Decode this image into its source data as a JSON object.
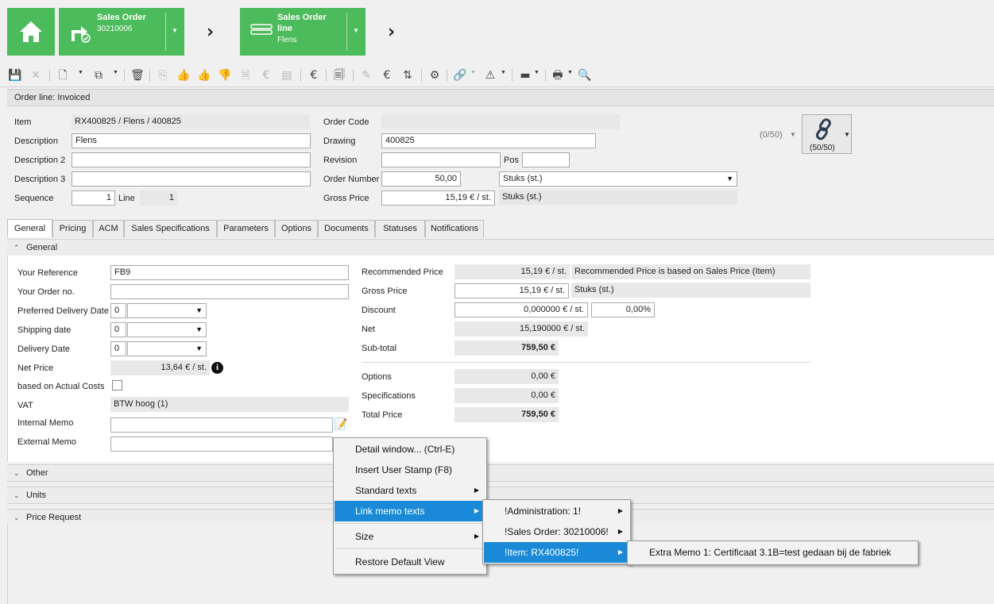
{
  "breadcrumb": {
    "tile1": {
      "title": "Sales Order",
      "sub": "30210006"
    },
    "tile2": {
      "title": "Sales Order",
      "title2": "line",
      "sub": "Flens"
    }
  },
  "colors": {
    "accent": "#4cbb5b",
    "highlight": "#1a8ad8"
  },
  "toolbar": {
    "icons": [
      "save-icon",
      "discard-icon",
      "new-document-icon",
      "copy-icon",
      "delete-icon",
      "process-icon",
      "approve-icon",
      "approve-all-icon",
      "reject-icon",
      "invoice-icon",
      "price-icon",
      "price-list-icon",
      "info-price-icon",
      "report-icon",
      "deliver-icon",
      "currency-icon",
      "transfer-icon",
      "configure-icon",
      "link-icon",
      "warning-icon",
      "keyboard-icon",
      "print-icon",
      "preview-icon"
    ]
  },
  "header": {
    "status": "Order line: Invoiced",
    "item_label": "Item",
    "item_value": "RX400825 / Flens / 400825",
    "description_label": "Description",
    "description_value": "Flens",
    "description2_label": "Description 2",
    "description2_value": "",
    "description3_label": "Description 3",
    "description3_value": "",
    "sequence_label": "Sequence",
    "sequence_value": "1",
    "line_label": "Line",
    "line_value": "1",
    "order_code_label": "Order Code",
    "order_code_value": "",
    "drawing_label": "Drawing",
    "drawing_value": "400825",
    "revision_label": "Revision",
    "revision_value": "",
    "pos_label": "Pos",
    "pos_value": "",
    "order_number_label": "Order Number",
    "order_number_value": "50,00",
    "unit_select": "Stuks (st.)",
    "gross_price_label": "Gross Price",
    "gross_price_value": "15,19 € / st.",
    "gross_price_unit": "Stuks (st.)",
    "counter": "(0/50)",
    "link_button_count": "(50/50)"
  },
  "tabs": [
    "General",
    "Pricing",
    "ACM",
    "Sales Specifications",
    "Parameters",
    "Options",
    "Documents",
    "Statuses",
    "Notifications"
  ],
  "general": {
    "section_title": "General",
    "your_reference_label": "Your Reference",
    "your_reference_value": "FB9",
    "your_order_label": "Your Order no.",
    "your_order_value": "",
    "pref_delivery_label": "Preferred Delivery Date",
    "pref_delivery_num": "0",
    "shipping_label": "Shipping date",
    "shipping_num": "0",
    "delivery_label": "Delivery Date",
    "delivery_num": "0",
    "net_price_label": "Net Price",
    "net_price_value": "13,64 € / st.",
    "actual_costs_label": "based on Actual Costs",
    "vat_label": "VAT",
    "vat_value": "BTW hoog (1)",
    "internal_memo_label": "Internal Memo",
    "internal_memo_value": "",
    "external_memo_label": "External Memo",
    "external_memo_value": "",
    "recommended_price_label": "Recommended Price",
    "recommended_price_value": "15,19 € / st.",
    "recommended_note": "Recommended Price is based on Sales Price (Item)",
    "gross_price_label": "Gross Price",
    "gross_price_value": "15,19 € / st.",
    "gross_price_unit": "Stuks (st.)",
    "discount_label": "Discount",
    "discount_value": "0,000000 € / st.",
    "discount_pct": "0,00%",
    "net_label": "Net",
    "net_value": "15,190000 € / st.",
    "subtotal_label": "Sub-total",
    "subtotal_value": "759,50 €",
    "options_label": "Options",
    "options_value": "0,00 €",
    "specifications_label": "Specifications",
    "specifications_value": "0,00 €",
    "total_label": "Total Price",
    "total_value": "759,50 €"
  },
  "sections": {
    "other": "Other",
    "units": "Units",
    "price_request": "Price Request"
  },
  "context_menu": {
    "items": [
      "Detail window... (Ctrl-E)",
      "Insert User Stamp (F8)",
      "Standard texts",
      "Link memo texts",
      "Size",
      "Restore Default View"
    ]
  },
  "submenu": {
    "items": [
      "!Administration: 1!",
      "!Sales Order: 30210006!",
      "!Item: RX400825!"
    ]
  },
  "submenu2": {
    "items": [
      "Extra Memo 1: Certificaat 3.1B=test gedaan bij de fabriek"
    ]
  }
}
